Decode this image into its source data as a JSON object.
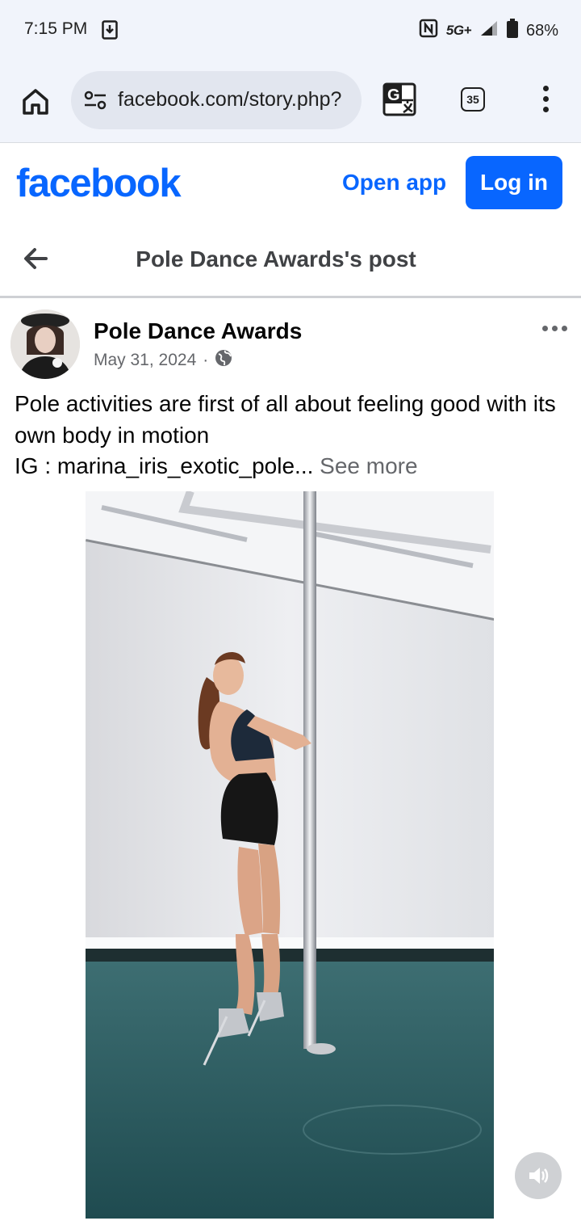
{
  "status_bar": {
    "time": "7:15 PM",
    "network": "5G+",
    "battery": "68%",
    "icons": [
      "download-icon",
      "nfc-icon",
      "signal-icon",
      "battery-icon"
    ]
  },
  "browser": {
    "url": "facebook.com/story.php?",
    "tab_count": "35",
    "icons": [
      "home-icon",
      "site-settings-icon",
      "translate-icon",
      "more-vert-icon"
    ]
  },
  "fb_header": {
    "logo": "facebook",
    "open_app_label": "Open app",
    "login_label": "Log in",
    "brand_color": "#0866ff"
  },
  "post_header": {
    "title": "Pole Dance Awards's post"
  },
  "post": {
    "author": "Pole Dance Awards",
    "date": "May 31, 2024",
    "separator": "·",
    "text_line1": "Pole activities are first of all about feeling good with its own body in motion",
    "text_line2": "IG : marina_iris_exotic_pole...",
    "see_more": "See more"
  },
  "video": {
    "audio_state": "muted"
  }
}
